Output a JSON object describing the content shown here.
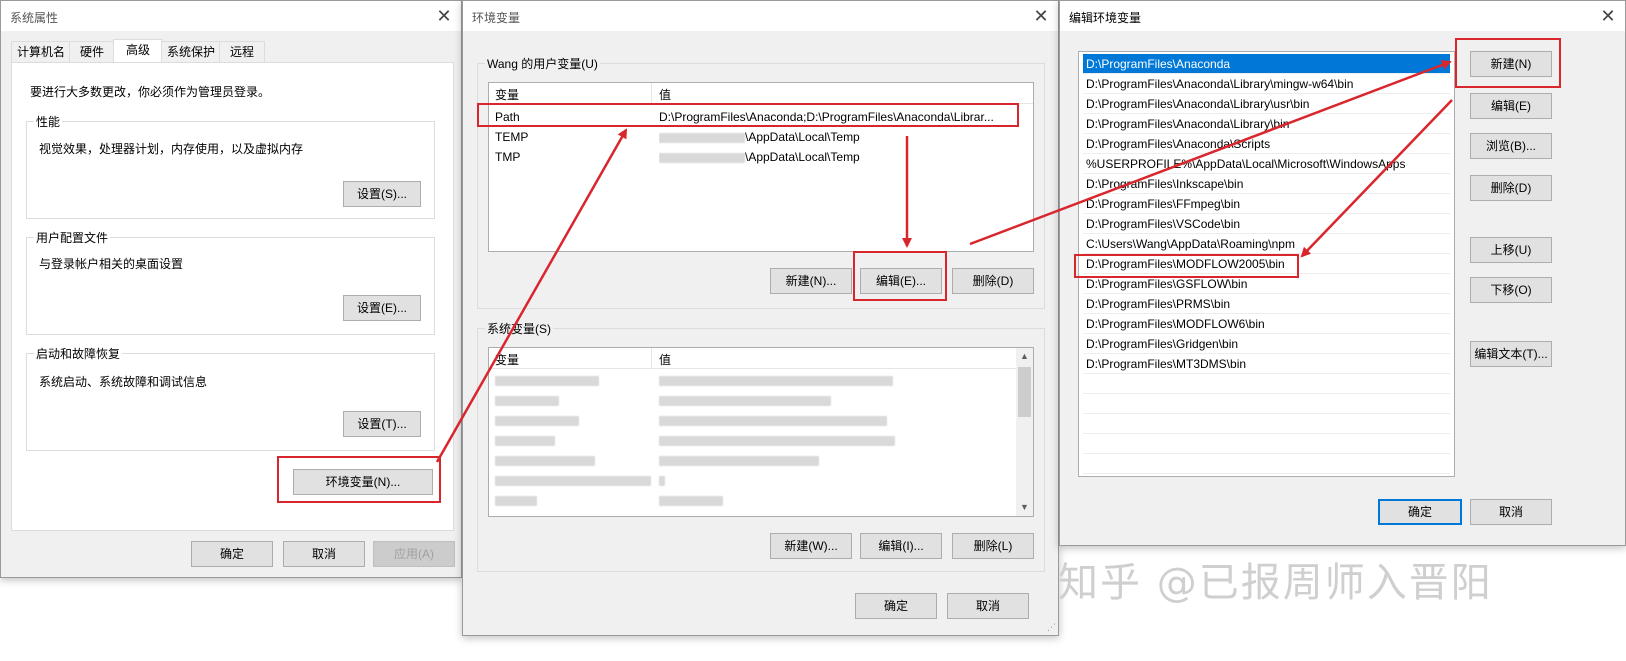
{
  "sysprops": {
    "title": "系统属性",
    "tabs": [
      "计算机名",
      "硬件",
      "高级",
      "系统保护",
      "远程"
    ],
    "admin_note": "要进行大多数更改，你必须作为管理员登录。",
    "perf": {
      "label": "性能",
      "desc": "视觉效果，处理器计划，内存使用，以及虚拟内存",
      "button": "设置(S)..."
    },
    "profile": {
      "label": "用户配置文件",
      "desc": "与登录帐户相关的桌面设置",
      "button": "设置(E)..."
    },
    "startup": {
      "label": "启动和故障恢复",
      "desc": "系统启动、系统故障和调试信息",
      "button": "设置(T)..."
    },
    "envvars_button": "环境变量(N)...",
    "ok": "确定",
    "cancel": "取消",
    "apply": "应用(A)"
  },
  "envvars": {
    "title": "环境变量",
    "user_group": "Wang 的用户变量(U)",
    "col_var": "变量",
    "col_val": "值",
    "user_rows": [
      {
        "var": "Path",
        "val": "D:\\ProgramFiles\\Anaconda;D:\\ProgramFiles\\Anaconda\\Librar..."
      },
      {
        "var": "TEMP",
        "val": "\\AppData\\Local\\Temp"
      },
      {
        "var": "TMP",
        "val": "\\AppData\\Local\\Temp"
      }
    ],
    "user_new": "新建(N)...",
    "user_edit": "编辑(E)...",
    "user_delete": "删除(D)",
    "sys_group": "系统变量(S)",
    "sys_new": "新建(W)...",
    "sys_edit": "编辑(I)...",
    "sys_delete": "删除(L)",
    "ok": "确定",
    "cancel": "取消"
  },
  "editenv": {
    "title": "编辑环境变量",
    "paths": [
      "D:\\ProgramFiles\\Anaconda",
      "D:\\ProgramFiles\\Anaconda\\Library\\mingw-w64\\bin",
      "D:\\ProgramFiles\\Anaconda\\Library\\usr\\bin",
      "D:\\ProgramFiles\\Anaconda\\Library\\bin",
      "D:\\ProgramFiles\\Anaconda\\Scripts",
      "%USERPROFILE%\\AppData\\Local\\Microsoft\\WindowsApps",
      "D:\\ProgramFiles\\Inkscape\\bin",
      "D:\\ProgramFiles\\FFmpeg\\bin",
      "D:\\ProgramFiles\\VSCode\\bin",
      "C:\\Users\\Wang\\AppData\\Roaming\\npm",
      "D:\\ProgramFiles\\MODFLOW2005\\bin",
      "D:\\ProgramFiles\\GSFLOW\\bin",
      "D:\\ProgramFiles\\PRMS\\bin",
      "D:\\ProgramFiles\\MODFLOW6\\bin",
      "D:\\ProgramFiles\\Gridgen\\bin",
      "D:\\ProgramFiles\\MT3DMS\\bin"
    ],
    "btn_new": "新建(N)",
    "btn_edit": "编辑(E)",
    "btn_browse": "浏览(B)...",
    "btn_delete": "删除(D)",
    "btn_up": "上移(U)",
    "btn_down": "下移(O)",
    "btn_edittext": "编辑文本(T)...",
    "ok": "确定",
    "cancel": "取消"
  },
  "watermark": "知乎 @已报周师入晋阳",
  "accent": "#0078d7",
  "annotation_color": "#d9262c"
}
